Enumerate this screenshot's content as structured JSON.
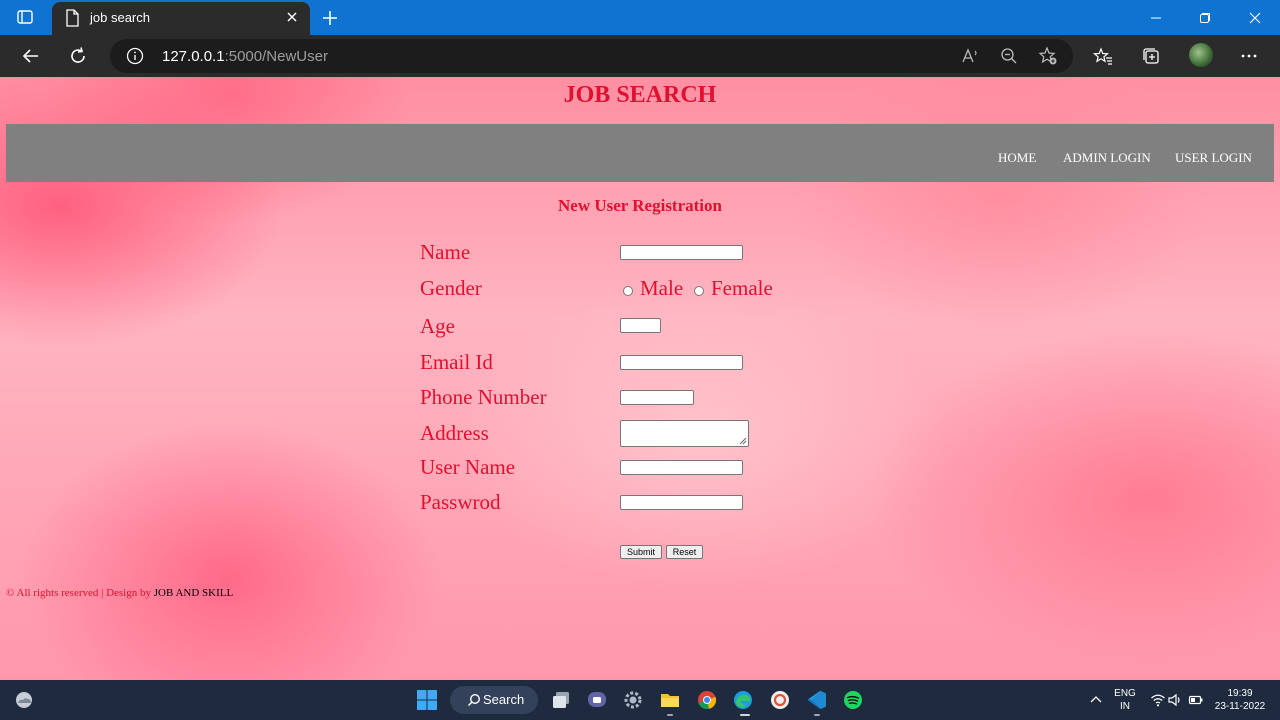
{
  "browser": {
    "tab_title": "job search",
    "url_host": "127.0.0.1",
    "url_rest": ":5000/NewUser"
  },
  "page": {
    "site_title": "JOB SEARCH",
    "nav": {
      "home": "HOME",
      "admin_login": "ADMIN LOGIN",
      "user_login": "USER LOGIN"
    },
    "form_heading": "New User Registration",
    "labels": {
      "name": "Name",
      "gender": "Gender",
      "age": "Age",
      "email": "Email Id",
      "phone": "Phone Number",
      "address": "Address",
      "username": "User Name",
      "password": "Passwrod"
    },
    "gender_options": {
      "male": "Male",
      "female": "Female"
    },
    "buttons": {
      "submit": "Submit",
      "reset": "Reset"
    },
    "footer": {
      "text": "© All rights reserved | Design by ",
      "brand": "JOB AND SKILL"
    }
  },
  "taskbar": {
    "search_label": "Search",
    "lang_line1": "ENG",
    "lang_line2": "IN",
    "time": "19:39",
    "date": "23-11-2022"
  },
  "colors": {
    "accent": "#e0102f",
    "nav_bg": "#808080",
    "tabbar": "#0f74d1"
  }
}
